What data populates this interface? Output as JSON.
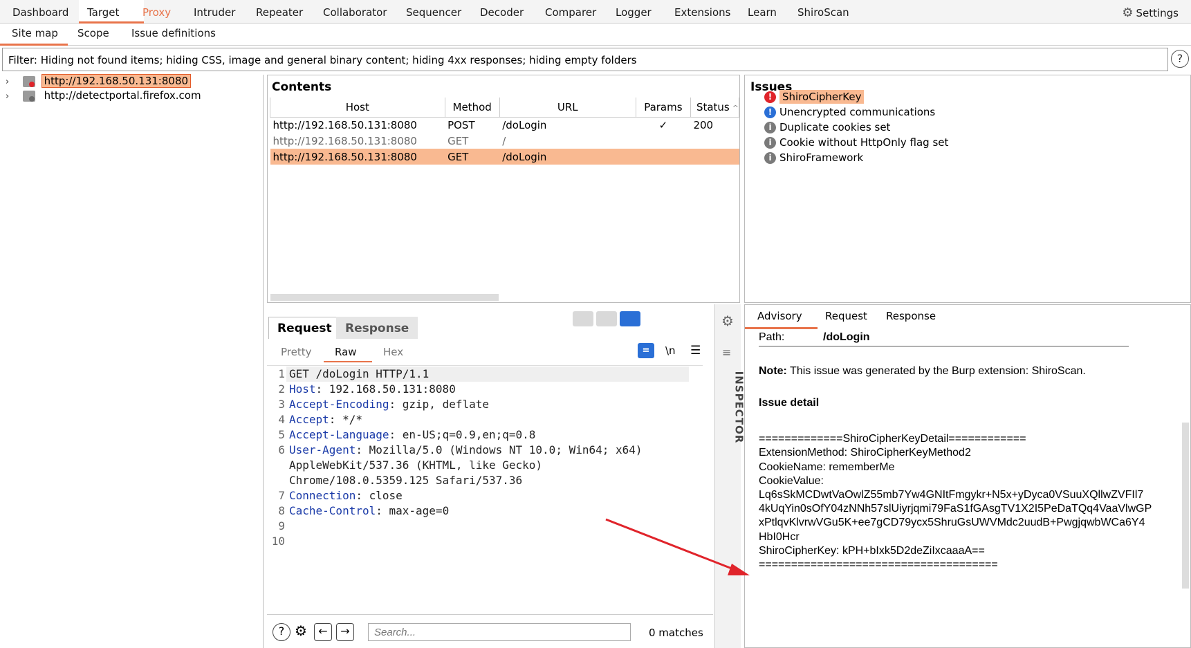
{
  "top_tabs": [
    "Dashboard",
    "Target",
    "Proxy",
    "Intruder",
    "Repeater",
    "Collaborator",
    "Sequencer",
    "Decoder",
    "Comparer",
    "Logger",
    "Extensions",
    "Learn",
    "ShiroScan"
  ],
  "settings_label": "Settings",
  "sub_tabs": [
    "Site map",
    "Scope",
    "Issue definitions"
  ],
  "filter_text": "Filter: Hiding not found items;  hiding CSS, image and general binary content;  hiding 4xx responses;  hiding empty folders",
  "help_label": "?",
  "tree": [
    {
      "label": "http://192.168.50.131:8080",
      "status_color": "#e0242b"
    },
    {
      "label": "http://detectportal.firefox.com",
      "status_color": "#7a7a7a"
    }
  ],
  "contents": {
    "title": "Contents",
    "columns": [
      "Host",
      "Method",
      "URL",
      "Params",
      "Status"
    ],
    "rows": [
      {
        "host": "http://192.168.50.131:8080",
        "method": "POST",
        "url": "/doLogin",
        "params": "✓",
        "status": "200"
      },
      {
        "host": "http://192.168.50.131:8080",
        "method": "GET",
        "url": "/",
        "params": "",
        "status": ""
      },
      {
        "host": "http://192.168.50.131:8080",
        "method": "GET",
        "url": "/doLogin",
        "params": "",
        "status": ""
      }
    ]
  },
  "issues": {
    "title": "Issues",
    "items": [
      {
        "label": "ShiroCipherKey",
        "badge": "!"
      },
      {
        "label": "Unencrypted communications",
        "badge": "!"
      },
      {
        "label": "Duplicate cookies set",
        "badge": "i"
      },
      {
        "label": "Cookie without HttpOnly flag set",
        "badge": "i"
      },
      {
        "label": "ShiroFramework",
        "badge": "i"
      }
    ]
  },
  "request_pane": {
    "tabs": [
      "Request",
      "Response"
    ],
    "subtabs": [
      "Pretty",
      "Raw",
      "Hex"
    ],
    "newline_label": "\\n",
    "lines": [
      {
        "n": "1",
        "key": "",
        "rest": "GET /doLogin HTTP/1.1"
      },
      {
        "n": "2",
        "key": "Host",
        "rest": ": 192.168.50.131:8080"
      },
      {
        "n": "3",
        "key": "Accept-Encoding",
        "rest": ": gzip, deflate"
      },
      {
        "n": "4",
        "key": "Accept",
        "rest": ": */*"
      },
      {
        "n": "5",
        "key": "Accept-Language",
        "rest": ": en-US;q=0.9,en;q=0.8"
      },
      {
        "n": "6",
        "key": "User-Agent",
        "rest": ": Mozilla/5.0 (Windows NT 10.0; Win64; x64)"
      },
      {
        "n": "",
        "key": "",
        "rest": "AppleWebKit/537.36 (KHTML, like Gecko)"
      },
      {
        "n": "",
        "key": "",
        "rest": "Chrome/108.0.5359.125 Safari/537.36"
      },
      {
        "n": "7",
        "key": "Connection",
        "rest": ": close"
      },
      {
        "n": "8",
        "key": "Cache-Control",
        "rest": ": max-age=0"
      },
      {
        "n": "9",
        "key": "",
        "rest": ""
      },
      {
        "n": "10",
        "key": "",
        "rest": ""
      }
    ],
    "search_placeholder": "Search...",
    "matches": "0 matches"
  },
  "inspector_label": "INSPECTOR",
  "advisory": {
    "tabs": [
      "Advisory",
      "Request",
      "Response"
    ],
    "path_label": "Path:",
    "path_value": "/doLogin",
    "note_label": "Note:",
    "note_text": "This issue was generated by the Burp extension: ShiroScan.",
    "detail_heading": "Issue detail",
    "detail_lines": [
      "=============ShiroCipherKeyDetail============",
      "ExtensionMethod: ShiroCipherKeyMethod2",
      "CookieName: rememberMe",
      "CookieValue:",
      "Lq6sSkMCDwtVaOwlZ55mb7Yw4GNItFmgykr+N5x+yDyca0VSuuXQllwZVFIl7",
      "4kUqYin0sOfY04zNNh57slUiyrjqmi79FaS1fGAsgTV1X2I5PeDaTQq4VaaVlwGP",
      "xPtlqvKlvrwVGu5K+ee7gCD79ycx5ShruGsUWVMdc2uudB+PwgjqwbWCa6Y4",
      "HbI0Hcr",
      "ShiroCipherKey: kPH+bIxk5D2deZiIxcaaaA==",
      "====================================="
    ]
  },
  "colors": {
    "accent": "#e8734a",
    "selection": "#f9b991",
    "blue": "#2a6fd6",
    "arrow": "#e0242b"
  }
}
